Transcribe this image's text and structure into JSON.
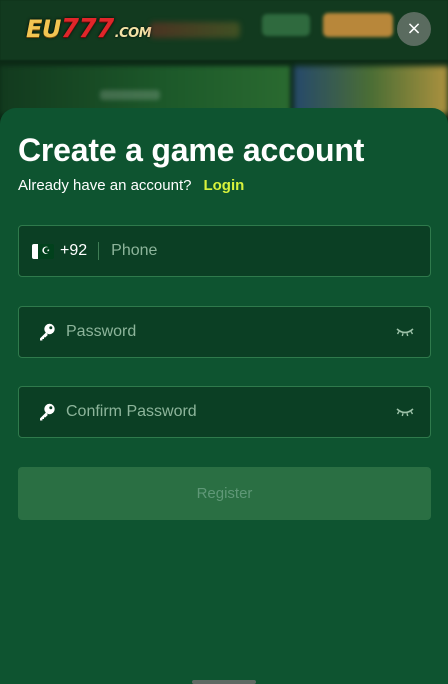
{
  "background": {
    "logo": {
      "eu": "EU",
      "digits": "777",
      "tld": ".COM"
    },
    "close_icon": "×"
  },
  "modal": {
    "title": "Create a game account",
    "subtitle": "Already have an account?",
    "login_link": "Login",
    "phone": {
      "flag_icon": "pakistan-flag-icon",
      "country_code": "+92",
      "placeholder": "Phone"
    },
    "password": {
      "placeholder": "Password",
      "icon": "key-icon",
      "toggle_icon": "eye-closed-icon"
    },
    "confirm_password": {
      "placeholder": "Confirm Password",
      "icon": "key-icon",
      "toggle_icon": "eye-closed-icon"
    },
    "register_label": "Register"
  },
  "colors": {
    "sheet": "#0e5430",
    "field": "#0b3f24",
    "field_border": "#2f7a4c",
    "accent_link": "#d8f23c",
    "register_disabled": "#2a6f43"
  }
}
